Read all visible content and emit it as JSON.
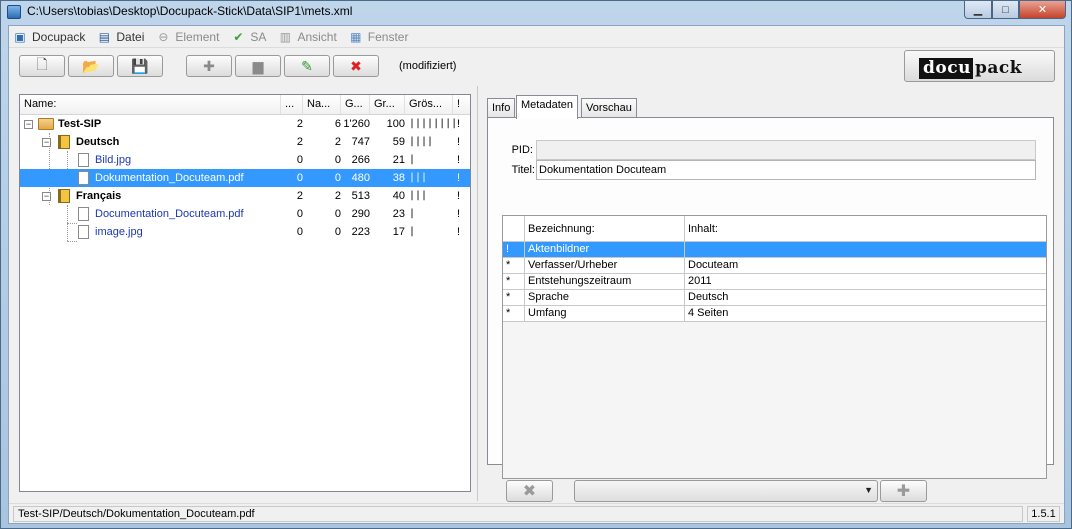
{
  "window": {
    "title": "C:\\Users\\tobias\\Desktop\\Docupack-Stick\\Data\\SIP1\\mets.xml",
    "minimize": "▁",
    "maximize": "□",
    "close": "✕"
  },
  "menu": {
    "items": [
      {
        "label": "Docupack",
        "icon": "docupack-cube-icon",
        "glyph": "▣",
        "disabled": false
      },
      {
        "label": "Datei",
        "icon": "floppy-disk-icon",
        "glyph": "▤",
        "disabled": false
      },
      {
        "label": "Element",
        "icon": "minus-circle-icon",
        "glyph": "⊖",
        "disabled": true
      },
      {
        "label": "SA",
        "icon": "checkmark-icon",
        "glyph": "✔",
        "disabled": true
      },
      {
        "label": "Ansicht",
        "icon": "document-view-icon",
        "glyph": "▥",
        "disabled": true
      },
      {
        "label": "Fenster",
        "icon": "window-list-icon",
        "glyph": "▦",
        "disabled": true
      }
    ]
  },
  "toolbar": {
    "new_glyph": "🗋",
    "open_glyph": "📂",
    "save_glyph": "💾",
    "add_glyph": "✚",
    "folder_glyph": "▆",
    "edit_glyph": "✎",
    "delete_glyph": "✖",
    "status": "(modifiziert)",
    "logo_left": "docu",
    "logo_right": "pack"
  },
  "tree": {
    "columns": [
      "Name:",
      "...",
      "Na...",
      "G...",
      "Gr...",
      "Grös...",
      "!"
    ],
    "rows": [
      {
        "name": "Test-SIP",
        "c1": "2",
        "c2": "6",
        "c3": "1'260",
        "c4": "100",
        "bars": "||||||||",
        "flag": "!"
      },
      {
        "name": "Deutsch",
        "c1": "2",
        "c2": "2",
        "c3": "747",
        "c4": "59",
        "bars": "||||",
        "flag": "!"
      },
      {
        "name": "Bild.jpg",
        "c1": "0",
        "c2": "0",
        "c3": "266",
        "c4": "21",
        "bars": "|",
        "flag": "!"
      },
      {
        "name": "Dokumentation_Docuteam.pdf",
        "c1": "0",
        "c2": "0",
        "c3": "480",
        "c4": "38",
        "bars": "|||",
        "flag": "!"
      },
      {
        "name": "Français",
        "c1": "2",
        "c2": "2",
        "c3": "513",
        "c4": "40",
        "bars": "|||",
        "flag": "!"
      },
      {
        "name": "Documentation_Docuteam.pdf",
        "c1": "0",
        "c2": "0",
        "c3": "290",
        "c4": "23",
        "bars": "|",
        "flag": "!"
      },
      {
        "name": "image.jpg",
        "c1": "0",
        "c2": "0",
        "c3": "223",
        "c4": "17",
        "bars": "|",
        "flag": "!"
      }
    ]
  },
  "details": {
    "tabs": [
      "Info",
      "Metadaten",
      "Vorschau"
    ],
    "active_tab": "Metadaten",
    "pid_label": "PID:",
    "pid_value": "",
    "titel_label": "Titel:",
    "titel_value": "Dokumentation Docuteam",
    "table_headers": [
      "Bezeichnung:",
      "Inhalt:"
    ],
    "table_rows": [
      {
        "mark": "!",
        "name": "Aktenbildner",
        "value": ""
      },
      {
        "mark": "*",
        "name": "Verfasser/Urheber",
        "value": "Docuteam"
      },
      {
        "mark": "*",
        "name": "Entstehungszeitraum",
        "value": "2011"
      },
      {
        "mark": "*",
        "name": "Sprache",
        "value": "Deutsch"
      },
      {
        "mark": "*",
        "name": "Umfang",
        "value": "4 Seiten"
      }
    ],
    "remove_glyph": "✖",
    "add_glyph": "✚",
    "combo_value": "",
    "combo_arrow": "▼"
  },
  "status": {
    "path": "Test-SIP/Deutsch/Dokumentation_Docuteam.pdf",
    "version": "1.5.1"
  },
  "colors": {
    "selection": "#3399ff",
    "link": "#1c36b8",
    "delete_red": "#e02020",
    "edit_green": "#2f9a2f"
  }
}
